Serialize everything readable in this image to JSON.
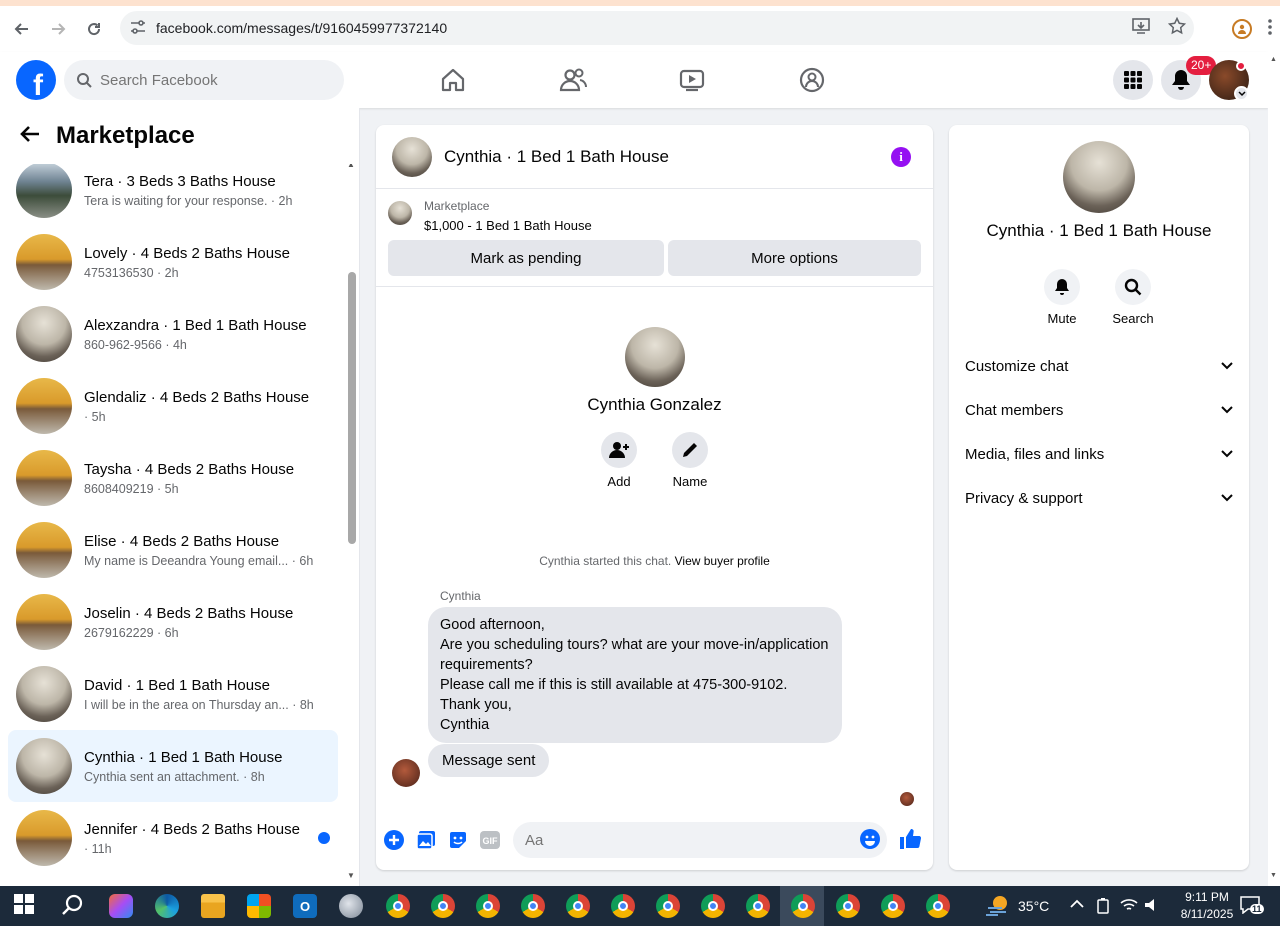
{
  "browser": {
    "url": "facebook.com/messages/t/9160459977372140"
  },
  "header": {
    "search_placeholder": "Search Facebook",
    "notifications_badge": "20+"
  },
  "left_panel": {
    "title": "Marketplace",
    "chats": [
      {
        "name": "Tera · 3 Beds 3 Baths House",
        "sub": "Tera is waiting for your response. · 2h",
        "thumb": "outdoor",
        "selected": false,
        "unread": false
      },
      {
        "name": "Lovely · 4 Beds 2 Baths House",
        "sub": "4753136530 · 2h",
        "thumb": "house",
        "selected": false,
        "unread": false
      },
      {
        "name": "Alexzandra · 1 Bed 1 Bath House",
        "sub": "860-962-9566 · 4h",
        "thumb": "room",
        "selected": false,
        "unread": false
      },
      {
        "name": "Glendaliz · 4 Beds 2 Baths House",
        "sub": " · 5h",
        "thumb": "house",
        "selected": false,
        "unread": false
      },
      {
        "name": "Taysha · 4 Beds 2 Baths House",
        "sub": "8608409219 · 5h",
        "thumb": "house",
        "selected": false,
        "unread": false
      },
      {
        "name": "Elise · 4 Beds 2 Baths House",
        "sub": "My name is Deeandra Young email... · 6h",
        "thumb": "house",
        "selected": false,
        "unread": false
      },
      {
        "name": "Joselin · 4 Beds 2 Baths House",
        "sub": "2679162229 · 6h",
        "thumb": "house",
        "selected": false,
        "unread": false
      },
      {
        "name": "David · 1 Bed 1 Bath House",
        "sub": "I will be in the area on Thursday an... · 8h",
        "thumb": "room",
        "selected": false,
        "unread": false
      },
      {
        "name": "Cynthia · 1 Bed 1 Bath House",
        "sub": "Cynthia sent an attachment. · 8h",
        "thumb": "room",
        "selected": true,
        "unread": false
      },
      {
        "name": "Jennifer · 4 Beds 2 Baths House",
        "sub": " · 11h",
        "thumb": "house",
        "selected": false,
        "unread": true
      }
    ]
  },
  "chat": {
    "title": "Cynthia · 1 Bed 1 Bath House",
    "listing_label": "Marketplace",
    "listing_price": "$1,000 - 1 Bed 1 Bath House",
    "mark_pending": "Mark as pending",
    "more_options": "More options",
    "contact_name": "Cynthia Gonzalez",
    "add_label": "Add",
    "name_label": "Name",
    "started_text": "Cynthia started this chat. ",
    "view_profile": "View buyer profile",
    "sender": "Cynthia",
    "message": "Good afternoon,\nAre you scheduling tours? what are your move-in/application requirements?\nPlease call me if this is still available at 475-300-9102.\nThank you,\nCynthia",
    "sent_message": "Message sent",
    "composer_placeholder": "Aa"
  },
  "info_panel": {
    "title": "Cynthia · 1 Bed 1 Bath House",
    "mute_label": "Mute",
    "search_label": "Search",
    "sections": [
      "Customize chat",
      "Chat members",
      "Media, files and links",
      "Privacy & support"
    ]
  },
  "taskbar": {
    "temperature": "35°C",
    "time": "9:11 PM",
    "date": "8/11/2025",
    "notif_count": "11"
  },
  "colors": {
    "fb_blue": "#0866ff",
    "messenger_purple": "#9510f2",
    "badge_red": "#e41e3f"
  }
}
